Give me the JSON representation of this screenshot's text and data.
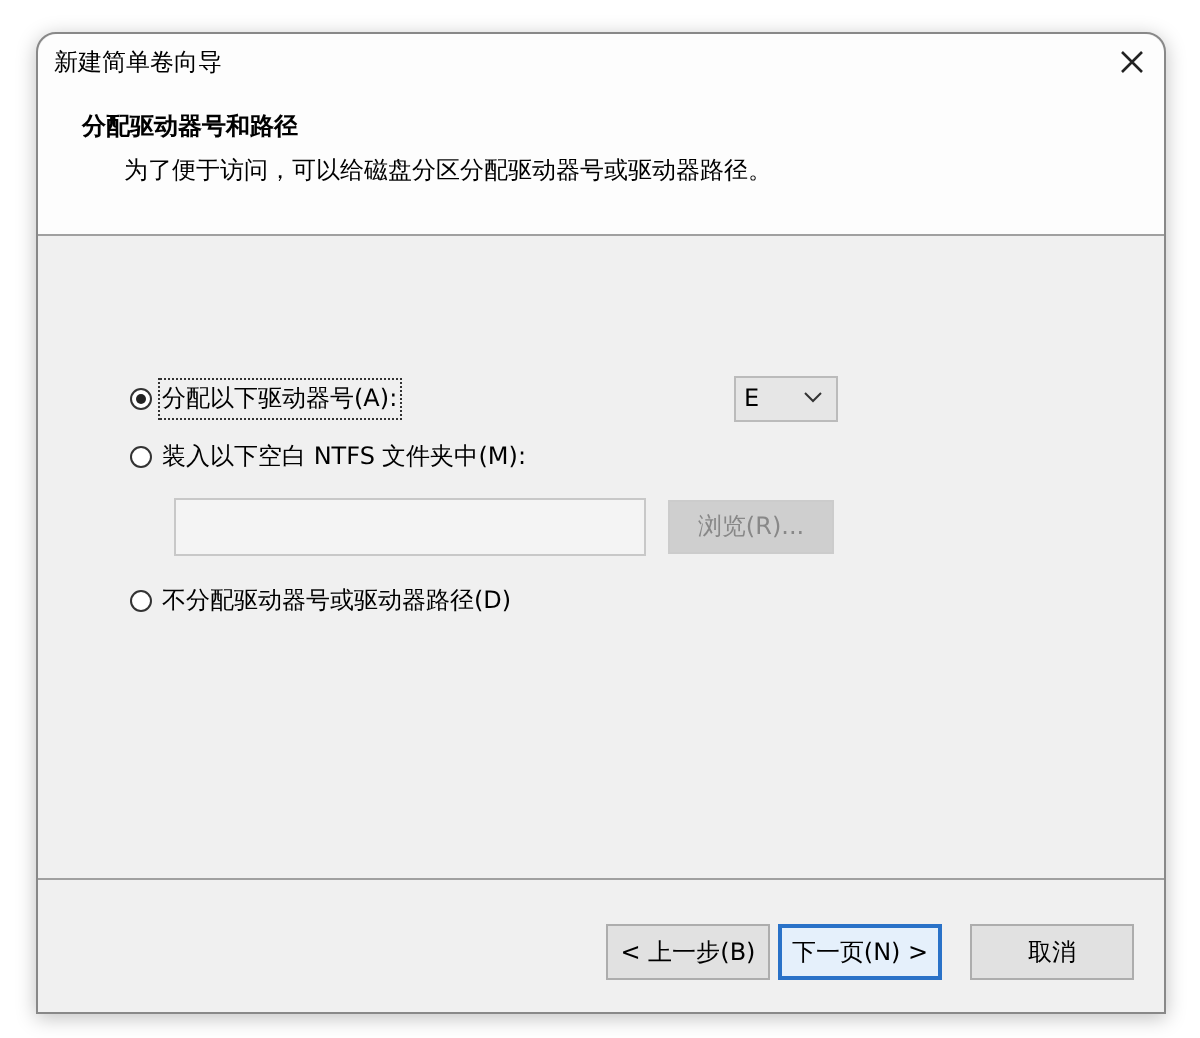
{
  "window": {
    "title": "新建简单卷向导"
  },
  "header": {
    "title": "分配驱动器号和路径",
    "description": "为了便于访问，可以给磁盘分区分配驱动器号或驱动器路径。"
  },
  "options": [
    {
      "label": "分配以下驱动器号(A):",
      "selected": true,
      "focused": true
    },
    {
      "label": "装入以下空白 NTFS 文件夹中(M):",
      "selected": false,
      "focused": false
    },
    {
      "label": "不分配驱动器号或驱动器路径(D)",
      "selected": false,
      "focused": false
    }
  ],
  "drive_letter": {
    "value": "E"
  },
  "browse_button": {
    "label": "浏览(R)...",
    "disabled": true
  },
  "buttons": [
    {
      "label": "< 上一步(B)",
      "focused": false
    },
    {
      "label": "下一页(N) >",
      "focused": true
    },
    {
      "label": "取消",
      "focused": false
    }
  ]
}
